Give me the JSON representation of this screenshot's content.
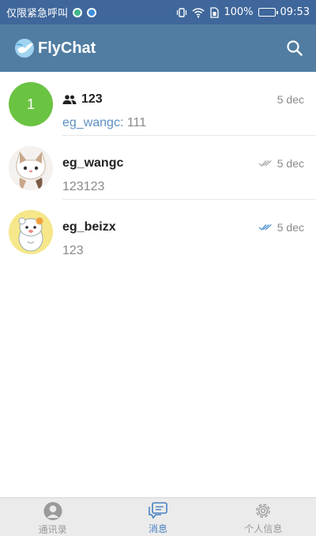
{
  "status_bar": {
    "carrier_text": "仅限紧急呼叫",
    "battery": "100%",
    "time": "09:53"
  },
  "app_bar": {
    "title": "FlyChat"
  },
  "chats": [
    {
      "avatar_text": "1",
      "name": "123",
      "is_group": true,
      "date": "5 dec",
      "preview_sender": "eg_wangc:",
      "preview_text": " 111",
      "read_status": "none"
    },
    {
      "avatar_text": "",
      "name": "eg_wangc",
      "is_group": false,
      "date": "5 dec",
      "preview_sender": "",
      "preview_text": "123123",
      "read_status": "read-gray"
    },
    {
      "avatar_text": "",
      "name": "eg_beizx",
      "is_group": false,
      "date": "5 dec",
      "preview_sender": "",
      "preview_text": "123",
      "read_status": "read-blue"
    }
  ],
  "tabs": [
    {
      "label": "通讯录",
      "icon": "contacts-icon",
      "active": false
    },
    {
      "label": "消息",
      "icon": "messages-icon",
      "active": true
    },
    {
      "label": "个人信息",
      "icon": "settings-icon",
      "active": false
    }
  ],
  "colors": {
    "status_bar": "#3f679b",
    "app_bar": "#517da2",
    "avatar_green": "#6bc342",
    "accent_blue": "#4a82c2",
    "sender_blue": "#5c8fc0"
  }
}
